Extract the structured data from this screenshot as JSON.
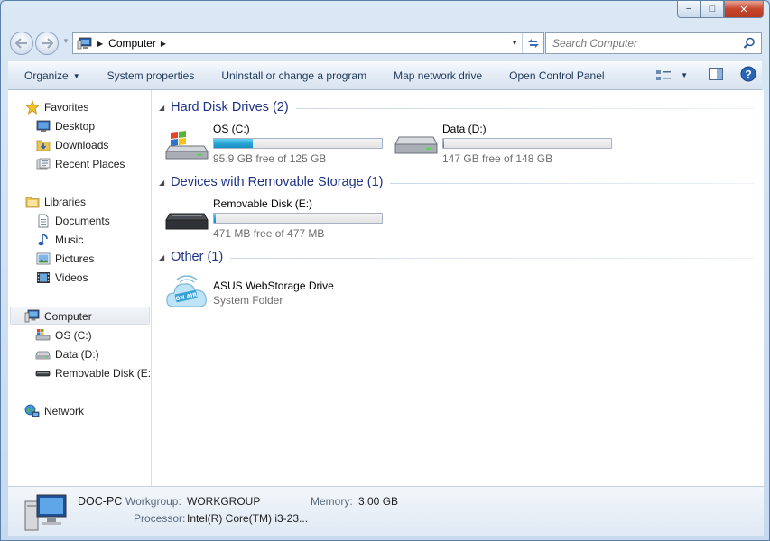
{
  "window": {
    "caption": {
      "minimize": "−",
      "maximize": "□",
      "close": "✕"
    }
  },
  "nav": {
    "back_icon": "back-arrow-icon",
    "forward_icon": "forward-arrow-icon",
    "address": {
      "location": "Computer",
      "separator": "▶"
    },
    "search_placeholder": "Search Computer"
  },
  "toolbar": {
    "items": [
      {
        "label": "Organize",
        "has_caret": true
      },
      {
        "label": "System properties"
      },
      {
        "label": "Uninstall or change a program"
      },
      {
        "label": "Map network drive"
      },
      {
        "label": "Open Control Panel"
      }
    ],
    "view_icon": "change-view-icon",
    "preview_icon": "preview-pane-icon",
    "help_icon": "help-icon"
  },
  "navpane": {
    "favorites": {
      "label": "Favorites",
      "items": [
        "Desktop",
        "Downloads",
        "Recent Places"
      ]
    },
    "libraries": {
      "label": "Libraries",
      "items": [
        "Documents",
        "Music",
        "Pictures",
        "Videos"
      ]
    },
    "computer": {
      "label": "Computer",
      "items": [
        "OS (C:)",
        "Data (D:)",
        "Removable Disk (E:)"
      ]
    },
    "network": {
      "label": "Network"
    }
  },
  "content": {
    "groups": [
      {
        "title": "Hard Disk Drives (2)",
        "items": [
          {
            "name": "OS (C:)",
            "free": "95.9 GB free of 125 GB",
            "used_fraction": 0.233,
            "icon": "windows-drive-icon"
          },
          {
            "name": "Data (D:)",
            "free": "147 GB free of 148 GB",
            "used_fraction": 0.007,
            "icon": "hard-drive-icon"
          }
        ]
      },
      {
        "title": "Devices with Removable Storage (1)",
        "items": [
          {
            "name": "Removable Disk (E:)",
            "free": "471 MB free of 477 MB",
            "used_fraction": 0.013,
            "icon": "removable-drive-icon"
          }
        ]
      },
      {
        "title": "Other (1)",
        "items": [
          {
            "name": "ASUS WebStorage Drive",
            "subtitle": "System Folder",
            "icon": "cloud-folder-icon",
            "icon_text": "ON AIR"
          }
        ]
      }
    ]
  },
  "details": {
    "computer_name": "DOC-PC",
    "workgroup_label": "Workgroup:",
    "workgroup": "WORKGROUP",
    "memory_label": "Memory:",
    "memory": "3.00 GB",
    "processor_label": "Processor:",
    "processor": "Intel(R) Core(TM) i3-23..."
  },
  "colors": {
    "accent": "#1e3287",
    "bar_fill": "#27a3d4",
    "frame": "#c6d9ee"
  }
}
